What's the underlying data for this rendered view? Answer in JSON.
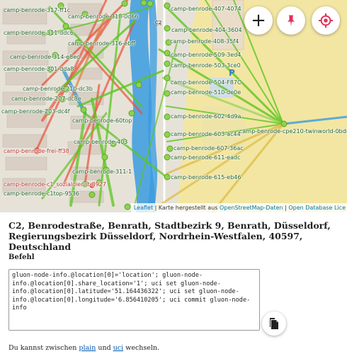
{
  "map": {
    "nodes": [
      {
        "label": "camp-benrode-317-ff1c",
        "color": "green"
      },
      {
        "label": "camp-benrode-318-0d66",
        "color": "green"
      },
      {
        "label": "camp-benrode-407-4074",
        "color": "green"
      },
      {
        "label": "camp-benrode-311-ddc6",
        "color": "green"
      },
      {
        "label": "camp-benrode-316-ebff",
        "color": "green"
      },
      {
        "label": "camp-benrode-404-3604",
        "color": "green"
      },
      {
        "label": "camp-benrode-408-35f4",
        "color": "green"
      },
      {
        "label": "camp-benrode-314-e8ec",
        "color": "green"
      },
      {
        "label": "camp-benrode-509-3ed4",
        "color": "green"
      },
      {
        "label": "camp-benrode-301-dda8",
        "color": "green"
      },
      {
        "label": "camp-benrode-503-3ce0",
        "color": "green"
      },
      {
        "label": "camp-benrode-504-F87C",
        "color": "green"
      },
      {
        "label": "camp-benrode-210-dc3b",
        "color": "green"
      },
      {
        "label": "camp-benrode-510-de0e",
        "color": "green"
      },
      {
        "label": "camp-benrode-207-dc8e",
        "color": "green"
      },
      {
        "label": "camp-benrode-203-dc4f",
        "color": "green"
      },
      {
        "label": "camp-benrode-602-4d9a",
        "color": "green"
      },
      {
        "label": "camp-benrode-cpe210-twinworld-0bd8",
        "color": "green"
      },
      {
        "label": "camp-benrode-603-ac44",
        "color": "green"
      },
      {
        "label": "camp-benrode-607-36ac",
        "color": "green"
      },
      {
        "label": "camp-benrode-frei-ff38",
        "color": "red"
      },
      {
        "label": "camp-benrode-611-eadc",
        "color": "green"
      },
      {
        "label": "camp-benrode-615-eb46",
        "color": "green"
      },
      {
        "label": "camp-benrode-c1_sozialdienst-8927",
        "color": "red"
      },
      {
        "label": "camp-benrode-c1top-9536",
        "color": "green"
      },
      {
        "label": "camp-benrode-60top",
        "color": "green"
      },
      {
        "label": "camp-benrode-403",
        "color": "green"
      },
      {
        "label": "camp-benrode-311-1",
        "color": "green"
      }
    ],
    "street_label": "C4",
    "street_label_2": "C2",
    "parking_label": "P",
    "buttons": {
      "zoom_in": "+",
      "pin_icon": "pin-icon",
      "locate_icon": "locate-icon"
    },
    "attribution": {
      "leaflet": "Leaflet",
      "separator_1": " | Karte hergestellt aus ",
      "osm": "OpenStreetMap-Daten",
      "separator_2": " | ",
      "odbl": "Open Database Lice"
    }
  },
  "address": "C2, Benrodestraße, Benrath, Stadtbezirk 9, Benrath, Düsseldorf, Regierungsbezirk Düsseldorf, Nordrhein-Westfalen, 40597, Deutschland",
  "command": {
    "heading": "Befehl",
    "text": "gluon-node-info.@location[0]='location'; gluon-node-info.@location[0].share_location='1'; uci set gluon-node-info.@location[0].latitude='51.164436322'; uci set gluon-node-info.@location[0].longitude='6.856410205'; uci commit gluon-node-info",
    "copy_icon": "copy-icon"
  },
  "switch": {
    "prefix": "Du kannst zwischen ",
    "plain": "plain",
    "middle": " und ",
    "uci": "uci",
    "suffix": " wechseln."
  },
  "colors": {
    "link_green": "#5cc421",
    "link_red": "#e8533a",
    "link_blue": "#3a9be0",
    "node_fill": "#8fd14f",
    "button_red": "#e0315a"
  }
}
